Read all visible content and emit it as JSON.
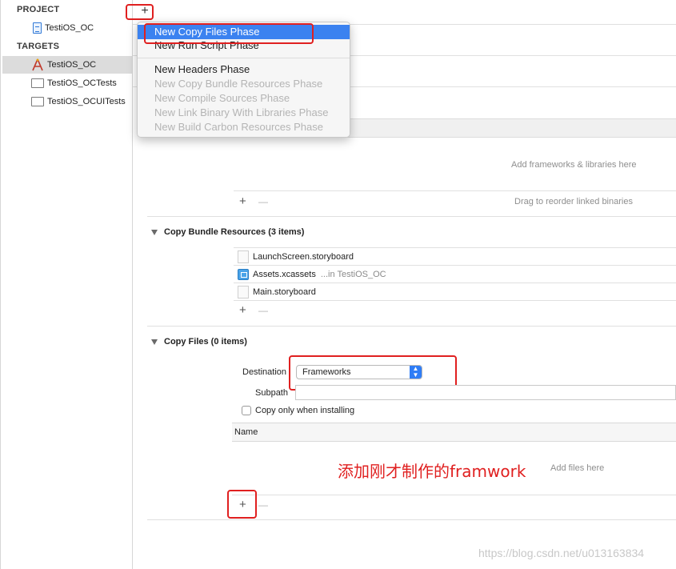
{
  "sidebar": {
    "project_header": "PROJECT",
    "project_item": "TestiOS_OC",
    "targets_header": "TARGETS",
    "targets": [
      "TestiOS_OC",
      "TestiOS_OCTests",
      "TestiOS_OCUITests"
    ]
  },
  "toolbar": {
    "add_label": "+"
  },
  "menu": {
    "items": [
      "New Copy Files Phase",
      "New Run Script Phase",
      "New Headers Phase",
      "New Copy Bundle Resources Phase",
      "New Compile Sources Phase",
      "New Link Binary With Libraries Phase",
      "New Build Carbon Resources Phase"
    ]
  },
  "link_section": {
    "placeholder": "Add frameworks & libraries here",
    "add": "+",
    "remove": "—",
    "hint": "Drag to reorder linked binaries"
  },
  "bundle_section": {
    "title": "Copy Bundle Resources (3 items)",
    "files": [
      {
        "name": "LaunchScreen.storyboard",
        "suffix": ""
      },
      {
        "name": "Assets.xcassets",
        "suffix": "...in TestiOS_OC"
      },
      {
        "name": "Main.storyboard",
        "suffix": ""
      }
    ],
    "add": "+",
    "remove": "—"
  },
  "copy_section": {
    "title": "Copy Files (0 items)",
    "destination_label": "Destination",
    "destination_value": "Frameworks",
    "subpath_label": "Subpath",
    "subpath_value": "",
    "copy_only_label": "Copy only when installing",
    "column_name": "Name",
    "placeholder": "Add files here",
    "add": "+",
    "remove": "—"
  },
  "annotation": "添加刚才制作的framwork",
  "watermark": "https://blog.csdn.net/u013163834",
  "colors": {
    "accent": "#3b82f0",
    "annotation_red": "#e02020"
  }
}
